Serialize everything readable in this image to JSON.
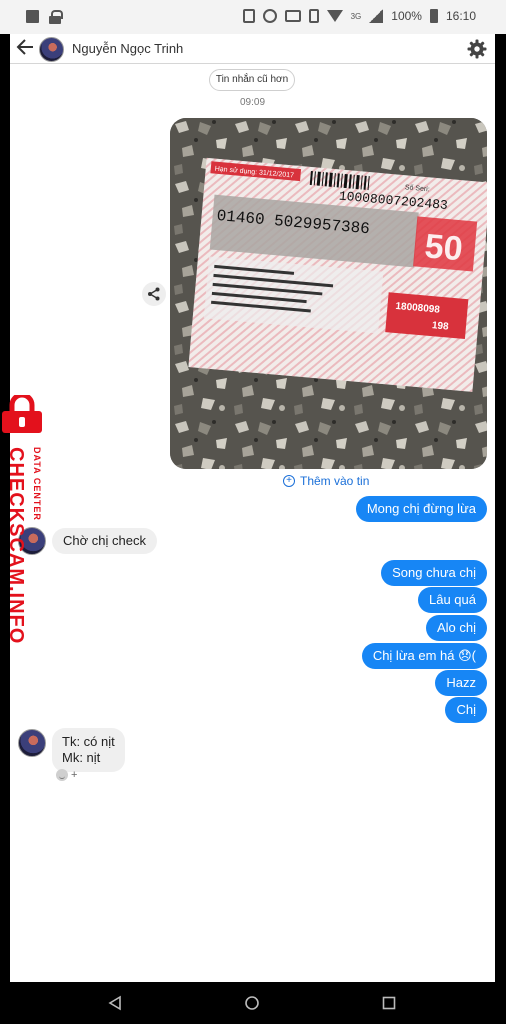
{
  "statusbar": {
    "network": "3G",
    "battery": "100%",
    "time": "16:10"
  },
  "header": {
    "title": "Nguyễn Ngọc Trinh"
  },
  "thread": {
    "older_button": "Tin nhắn cũ hơn",
    "time": "09:09",
    "add_to_story": "Thêm vào tin"
  },
  "messages": {
    "m1": "Mong chị đừng lừa",
    "m2": "Chờ chị check",
    "m3": "Song chưa chị",
    "m4": "Lâu quá",
    "m5": "Alo chị",
    "m6": "Chị lừa em há 😞(",
    "m7": "Hazz",
    "m8": "Chị",
    "m9_line1": "Tk: có nịt",
    "m9_line2": "Mk: nịt"
  },
  "reaction": {
    "plus": "+"
  },
  "card": {
    "serial_label": "Số Seri:",
    "serial": "10008007202483",
    "code": "01460 5029957386",
    "amount": "50",
    "expiry": "Hạn sử dụng: 31/12/2017",
    "hotline1": "18008098",
    "hotline2": "198"
  },
  "watermark": {
    "main": "CHECKSCAM.INFO",
    "sub": "DATA CENTER"
  },
  "colors": {
    "outgoing": "#1786f5",
    "incoming": "#efefef",
    "link": "#1a6fd8",
    "watermark": "#e3111c"
  }
}
